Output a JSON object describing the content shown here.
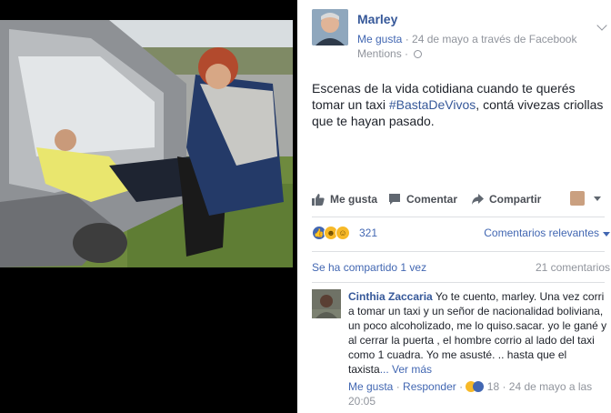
{
  "post": {
    "author": "Marley",
    "like_link": "Me gusta",
    "meta_date": " · 24 de mayo a través de Facebook",
    "meta_line2": "Mentions",
    "separator": " · ",
    "text_before": "Escenas de la vida cotidiana cuando te querés tomar un taxi ",
    "hashtag": "#BastaDeVivos",
    "text_after": ", contá vivezas criollas que te hayan pasado."
  },
  "actions": {
    "like": "Me gusta",
    "comment": "Comentar",
    "share": "Compartir"
  },
  "reactions": {
    "count": "321",
    "sort_label": "Comentarios relevantes"
  },
  "stats": {
    "shared": "Se ha compartido 1 vez",
    "comments": "21 comentarios"
  },
  "comment": {
    "author": "Cinthia Zaccaria",
    "text": " Yo te cuento, marley. Una vez corri a tomar un taxi y un señor de nacionalidad boliviana, un poco alcoholizado, me lo quiso.sacar. yo le gané y al cerrar la puerta , el hombre corrio al lado del taxi como 1 cuadra. Yo me asusté. .. hasta que el taxista",
    "more": "... Ver más",
    "like": "Me gusta",
    "reply": "Responder",
    "reaction_count": "18",
    "timestamp": "24 de mayo a las 20:05",
    "sep": " · "
  },
  "icons": {
    "like": "thumbs-up-icon",
    "comment": "speech-bubble-icon",
    "share": "share-arrow-icon",
    "privacy": "globe-icon",
    "menu": "chevron-down-icon"
  },
  "colors": {
    "link": "#365899",
    "accent": "#4267b2",
    "muted": "#90949c",
    "text": "#1d2129"
  }
}
